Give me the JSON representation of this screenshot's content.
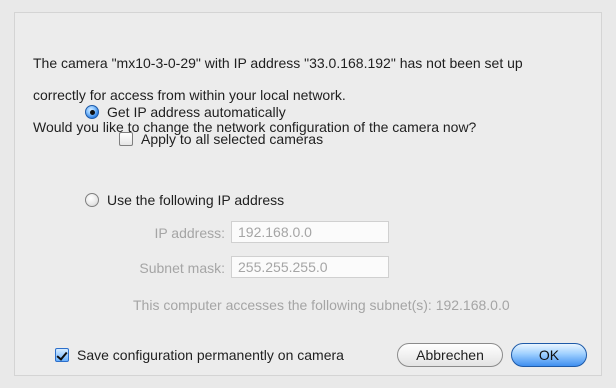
{
  "dialog": {
    "message_line1": "The camera \"mx10-3-0-29\" with IP address \"33.0.168.192\" has not been set up",
    "message_line2": "correctly for access from within your local network.",
    "message_line3": "Would you like to change the network configuration of the camera now?"
  },
  "options": {
    "auto_ip": {
      "label": "Get IP address automatically",
      "selected": true
    },
    "apply_all": {
      "label": "Apply to all selected cameras",
      "checked": false
    },
    "manual_ip": {
      "label": "Use the following IP address",
      "selected": false
    }
  },
  "fields": {
    "ip_address": {
      "label": "IP address:",
      "value": "192.168.0.0"
    },
    "subnet_mask": {
      "label": "Subnet mask:",
      "value": "255.255.255.0"
    }
  },
  "note": "This computer accesses the following subnet(s): 192.168.0.0",
  "footer": {
    "save_config": {
      "label": "Save configuration permanently on camera",
      "checked": true
    },
    "cancel_label": "Abbrechen",
    "ok_label": "OK"
  }
}
